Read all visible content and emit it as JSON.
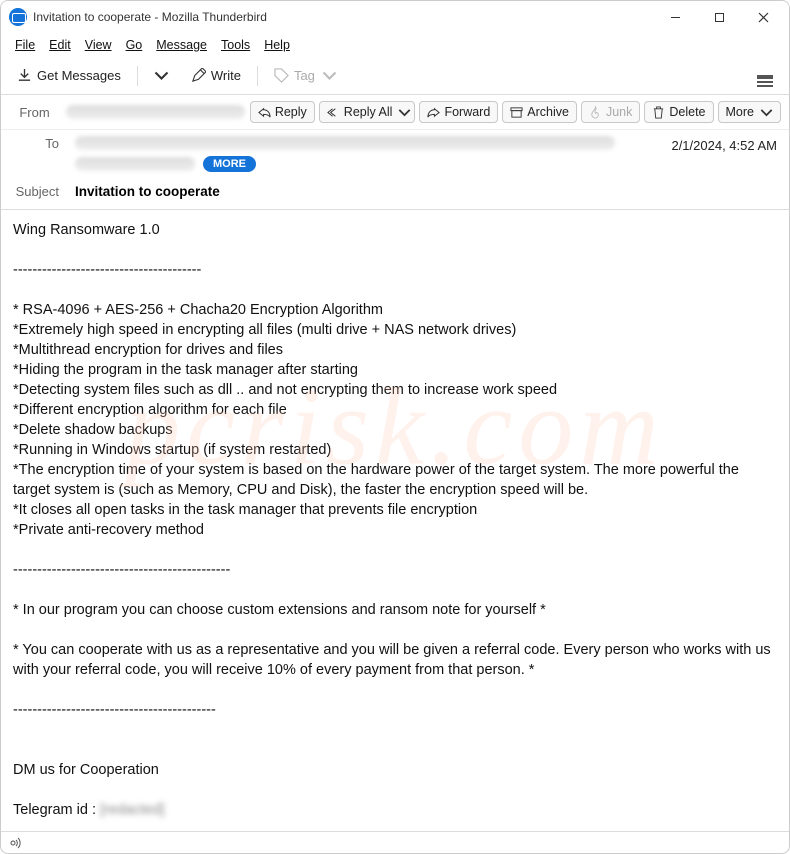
{
  "window": {
    "title": "Invitation to cooperate - Mozilla Thunderbird"
  },
  "menu": {
    "file": "File",
    "edit": "Edit",
    "view": "View",
    "go": "Go",
    "message": "Message",
    "tools": "Tools",
    "help": "Help"
  },
  "toolbar": {
    "get_messages": "Get Messages",
    "write": "Write",
    "tag": "Tag"
  },
  "actions": {
    "reply": "Reply",
    "reply_all": "Reply All",
    "forward": "Forward",
    "archive": "Archive",
    "junk": "Junk",
    "delete": "Delete",
    "more": "More"
  },
  "headers": {
    "from_label": "From",
    "to_label": "To",
    "subject_label": "Subject",
    "subject_value": "Invitation to cooperate",
    "more_pill": "MORE",
    "date": "2/1/2024, 4:52 AM"
  },
  "body": {
    "title": "Wing Ransomware 1.0",
    "sep1": "---------------------------------------",
    "f1": "* RSA-4096 + AES-256 + Chacha20 Encryption Algorithm",
    "f2": "*Extremely high speed in encrypting all files (multi drive + NAS network drives)",
    "f3": "*Multithread encryption for drives and files",
    "f4": "*Hiding the program in the task manager after starting",
    "f5": "*Detecting system files such as dll .. and not encrypting them to increase work speed",
    "f6": "*Different encryption algorithm for each file",
    "f7": "*Delete shadow backups",
    "f8": "*Running in Windows startup (if system restarted)",
    "f9": "*The encryption time of your system is based on the hardware power of the target system. The more powerful the target system is (such as Memory, CPU and Disk), the faster the encryption speed will be.",
    "f10": "*It closes all open tasks in the task manager that prevents file encryption",
    "f11": "*Private anti-recovery method",
    "sep2": "---------------------------------------------",
    "p1": "* In our program you can choose custom extensions and ransom note for yourself *",
    "p2": "* You can cooperate with us as a representative and you will be given a referral code. Every person who works with us with your referral code, you will receive 10% of every payment from that person. *",
    "sep3": "------------------------------------------",
    "dm": "DM us for Cooperation",
    "tg_label": "Telegram id : ",
    "tg_value": "[redacted]"
  },
  "watermark": "pcrisk.com"
}
